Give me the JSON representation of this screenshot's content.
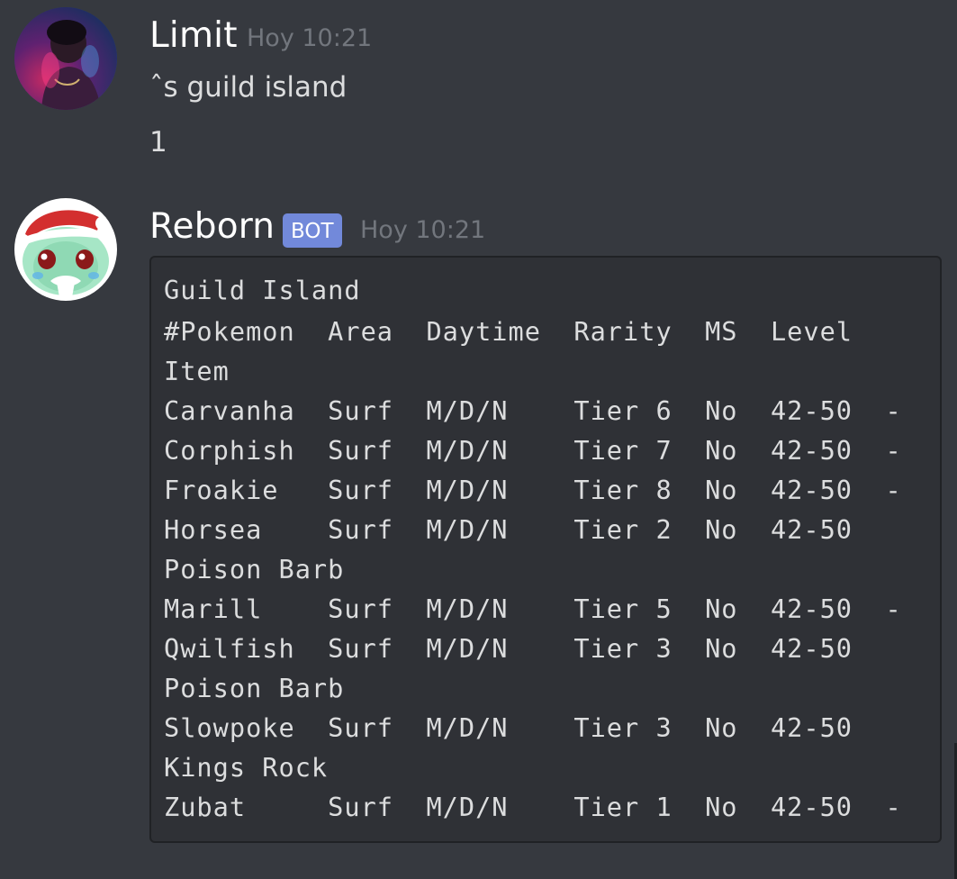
{
  "messages": [
    {
      "username": "Limit",
      "timestamp": "Hoy 10:21",
      "lines": [
        "ˆs guild island",
        "1"
      ]
    },
    {
      "username": "Reborn",
      "badge": "BOT",
      "timestamp": "Hoy 10:21",
      "code_lines": [
        "Guild Island",
        "#Pokemon  Area  Daytime  Rarity  MS  Level",
        "Item",
        "Carvanha  Surf  M/D/N    Tier 6  No  42-50  -",
        "Corphish  Surf  M/D/N    Tier 7  No  42-50  -",
        "Froakie   Surf  M/D/N    Tier 8  No  42-50  -",
        "Horsea    Surf  M/D/N    Tier 2  No  42-50",
        "Poison Barb",
        "Marill    Surf  M/D/N    Tier 5  No  42-50  -",
        "Qwilfish  Surf  M/D/N    Tier 3  No  42-50",
        "Poison Barb",
        "Slowpoke  Surf  M/D/N    Tier 3  No  42-50",
        "Kings Rock",
        "Zubat     Surf  M/D/N    Tier 1  No  42-50  -"
      ]
    }
  ],
  "colors": {
    "background": "#36393f",
    "code_background": "#2f3136",
    "badge": "#7289da",
    "timestamp": "#72767d",
    "text": "#dcddde"
  },
  "icons": [
    "user-avatar-limit",
    "bot-avatar-reborn"
  ]
}
